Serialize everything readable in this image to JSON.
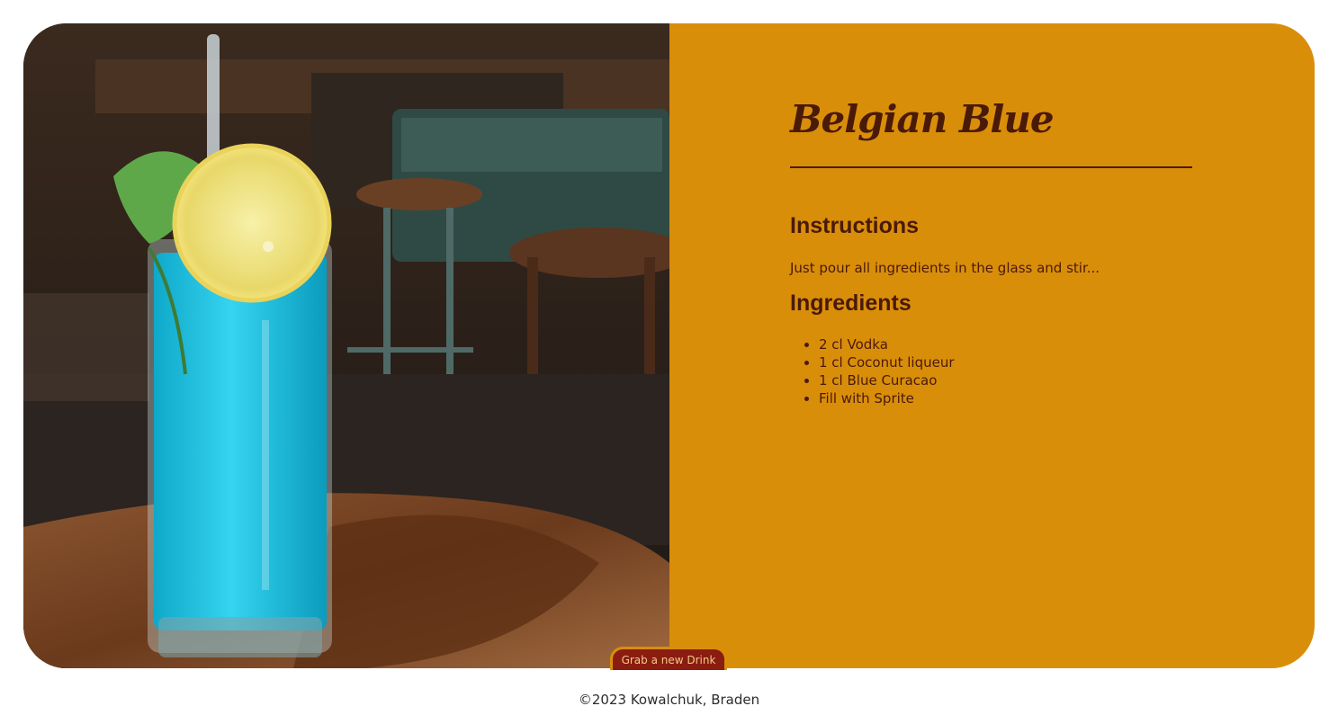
{
  "drink": {
    "name": "Belgian Blue",
    "image_alt": "Belgian Blue cocktail"
  },
  "instructions": {
    "heading": "Instructions",
    "text": "Just pour all ingredients in the glass and stir..."
  },
  "ingredients": {
    "heading": "Ingredients",
    "items": [
      "2 cl Vodka",
      "1 cl Coconut liqueur",
      "1 cl Blue Curacao",
      "Fill with Sprite"
    ]
  },
  "actions": {
    "new_drink_label": "Grab a new Drink"
  },
  "footer": {
    "copyright": "©2023 Kowalchuk, Braden"
  },
  "colors": {
    "panel_background": "#d98e0a",
    "text_dark_brown": "#4a1a08",
    "button_background": "#8a1c10",
    "button_text": "#f2c98a"
  }
}
